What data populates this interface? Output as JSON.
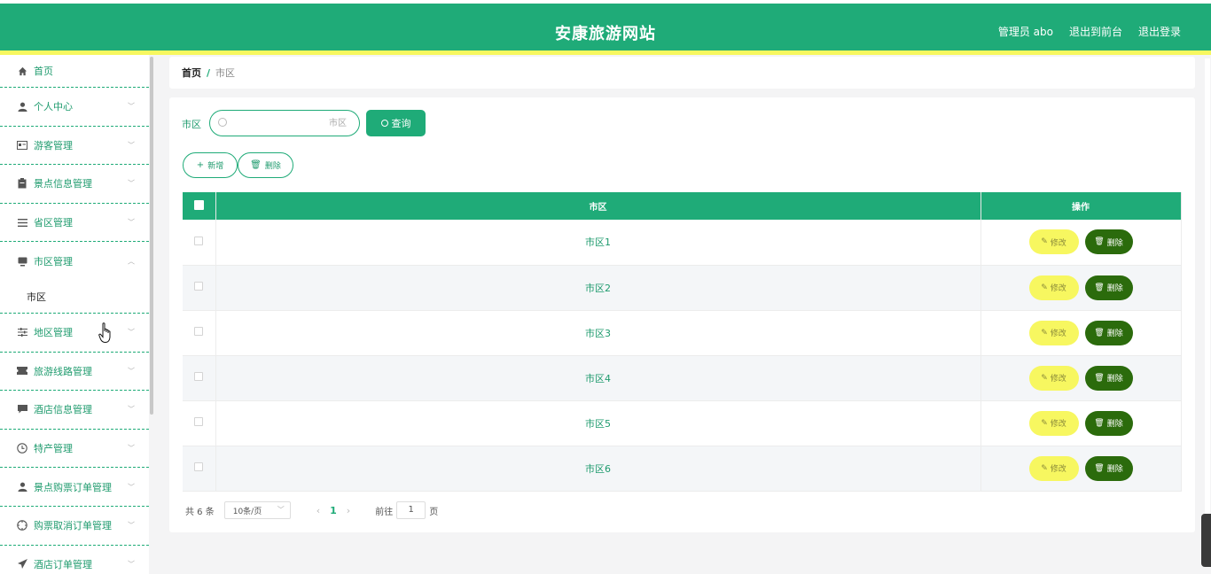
{
  "header": {
    "title": "安康旅游网站",
    "admin": "管理员 abo",
    "back_front": "退出到前台",
    "logout": "退出登录"
  },
  "sidebar": {
    "items": [
      {
        "label": "首页",
        "icon": "home-icon"
      },
      {
        "label": "个人中心",
        "icon": "user-icon"
      },
      {
        "label": "游客管理",
        "icon": "id-card-icon"
      },
      {
        "label": "景点信息管理",
        "icon": "clipboard-icon"
      },
      {
        "label": "省区管理",
        "icon": "list-icon"
      },
      {
        "label": "市区管理",
        "icon": "monitor-icon"
      },
      {
        "label": "地区管理",
        "icon": "sliders-icon"
      },
      {
        "label": "旅游线路管理",
        "icon": "ticket-icon"
      },
      {
        "label": "酒店信息管理",
        "icon": "chat-icon"
      },
      {
        "label": "特产管理",
        "icon": "clock-icon"
      },
      {
        "label": "景点购票订单管理",
        "icon": "user-icon"
      },
      {
        "label": "购票取消订单管理",
        "icon": "compass-icon"
      },
      {
        "label": "酒店订单管理",
        "icon": "send-icon"
      }
    ],
    "sub_item": "市区"
  },
  "breadcrumb": {
    "home": "首页",
    "separator": "/",
    "current": "市区"
  },
  "search": {
    "label": "市区",
    "placeholder": "市区",
    "button": "查询"
  },
  "actions": {
    "add": "新增",
    "delete": "删除"
  },
  "table": {
    "headers": [
      "市区",
      "操作"
    ],
    "rows": [
      "市区1",
      "市区2",
      "市区3",
      "市区4",
      "市区5",
      "市区6"
    ],
    "edit_label": "修改",
    "delete_label": "删除"
  },
  "pagination": {
    "total": "共 6 条",
    "page_size": "10条/页",
    "current_page": "1",
    "goto_label": "前往",
    "goto_value": "1",
    "page_unit": "页"
  },
  "colors": {
    "primary": "#1fab78",
    "accent_yellow": "#f7f760",
    "delete_dark_green": "#2b6b0c"
  }
}
